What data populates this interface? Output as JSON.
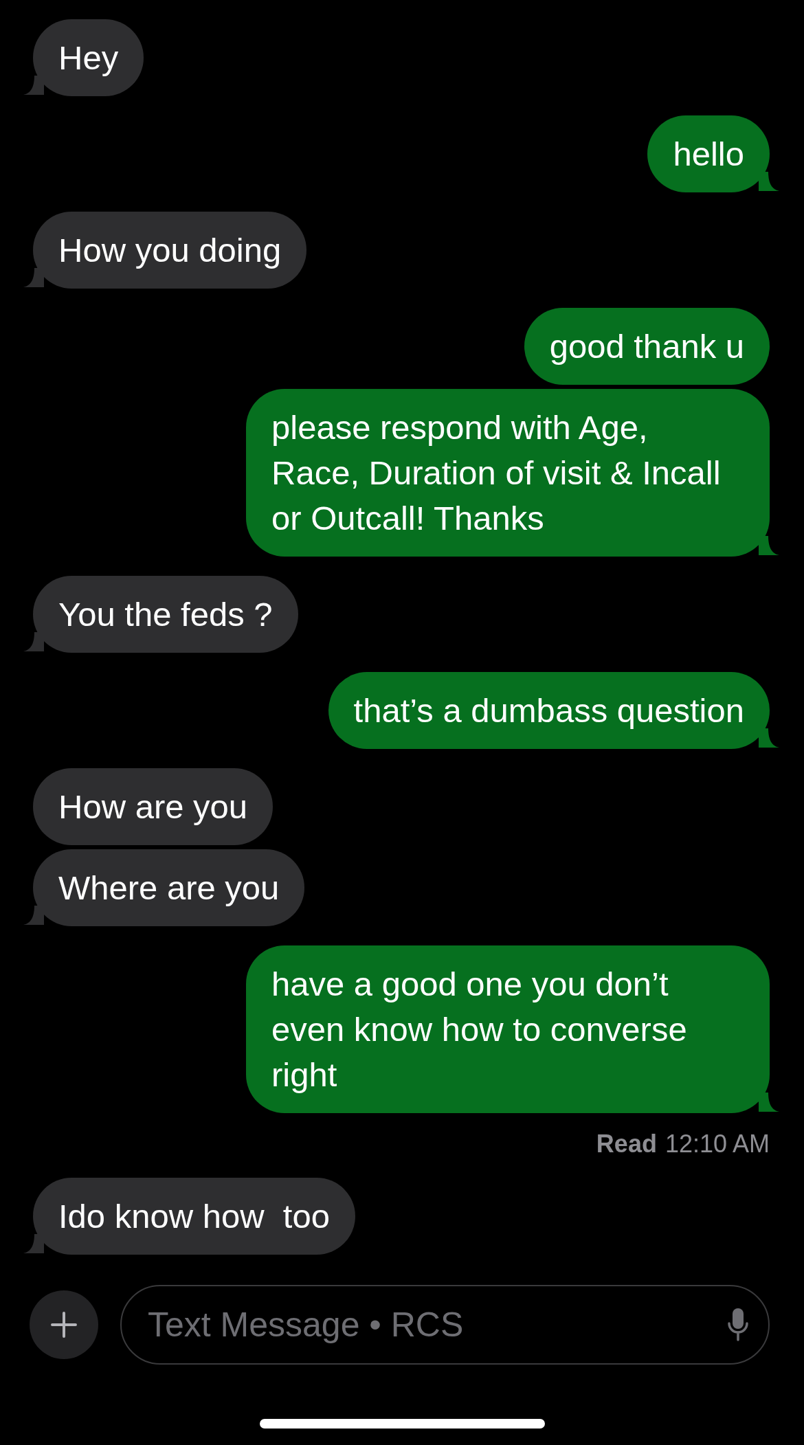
{
  "thread": [
    {
      "kind": "received",
      "text": "Hey",
      "tail": true
    },
    {
      "kind": "sent",
      "text": "hello",
      "tail": true
    },
    {
      "kind": "received",
      "text": "How you doing",
      "tail": true
    },
    {
      "kind": "sent",
      "text": "good thank u",
      "tail": false
    },
    {
      "kind": "sent",
      "text": "please respond with Age, Race, Duration of visit & Incall or Outcall! Thanks",
      "tail": true
    },
    {
      "kind": "received",
      "text": "You the feds ?",
      "tail": true
    },
    {
      "kind": "sent",
      "text": "that’s a dumbass question",
      "tail": true
    },
    {
      "kind": "received",
      "text": "How are you",
      "tail": false
    },
    {
      "kind": "received",
      "text": "Where are you",
      "tail": true
    },
    {
      "kind": "sent",
      "text": "have a good one you don’t even know how to converse right",
      "tail": true
    },
    {
      "kind": "receipt",
      "label": "Read",
      "time": "12:10 AM"
    },
    {
      "kind": "received",
      "text": "Ido know how  too",
      "tail": true
    }
  ],
  "composer": {
    "placeholder": "Text Message • RCS"
  }
}
